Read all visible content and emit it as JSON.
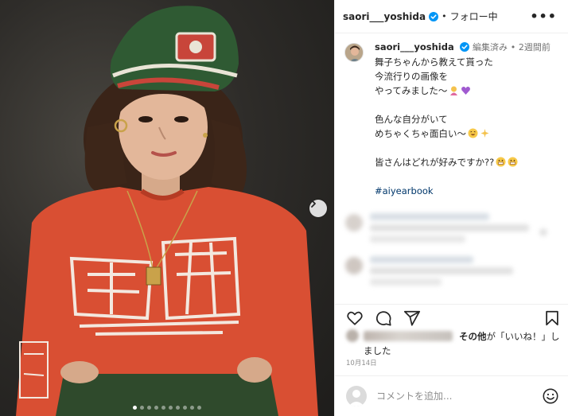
{
  "post": {
    "carousel_dots": 10,
    "active_dot": 0
  },
  "header": {
    "username": "saori___yoshida",
    "separator": "•",
    "follow_label": "フォロー中",
    "more_label": "•••"
  },
  "caption": {
    "username": "saori___yoshida",
    "edited": "編集済み",
    "separator": "•",
    "time": "2週間前",
    "lines": [
      "舞子ちゃんから教えて貰った",
      "今流行りの画像を",
      "やってみました〜",
      "",
      "色んな自分がいて",
      "めちゃくちゃ面白い〜",
      "",
      "皆さんはどれが好みですか??"
    ],
    "hashtag": "#aiyearbook"
  },
  "likes": {
    "text_suffix": "その他",
    "text_mid": "が「いいね！」し",
    "text_line2": "ました"
  },
  "date": "10月14日",
  "comment": {
    "placeholder": "コメントを追加..."
  },
  "icons": {
    "verified": "verified-badge-icon",
    "like": "heart-icon",
    "comment": "comment-icon",
    "share": "share-icon",
    "save": "bookmark-icon",
    "emoji": "smile-icon",
    "next": "chevron-right-icon",
    "more": "more-options-icon"
  },
  "colors": {
    "verified": "#0095f6",
    "hashtag": "#00376b",
    "shirt": "#d94f33",
    "hat": "#2f5a33"
  }
}
